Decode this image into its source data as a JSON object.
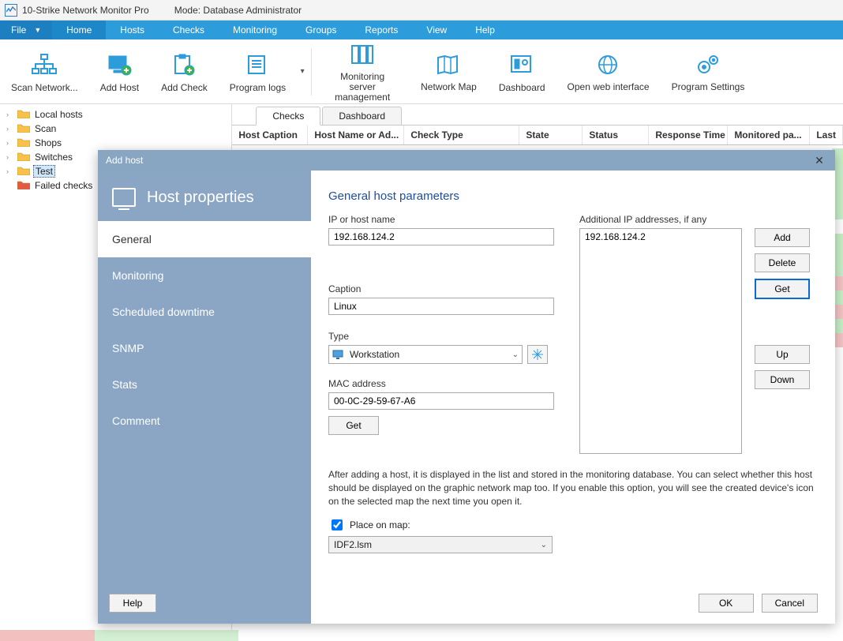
{
  "titlebar": {
    "app_name": "10-Strike Network Monitor Pro",
    "mode_label": "Mode: Database Administrator"
  },
  "menubar": {
    "file": "File",
    "items": [
      "Home",
      "Hosts",
      "Checks",
      "Monitoring",
      "Groups",
      "Reports",
      "View",
      "Help"
    ]
  },
  "toolbar": {
    "scan": "Scan Network...",
    "add_host": "Add Host",
    "add_check": "Add Check",
    "program_logs": "Program logs",
    "mon_server": "Monitoring server management",
    "net_map": "Network Map",
    "dashboard": "Dashboard",
    "open_web": "Open web interface",
    "settings": "Program Settings"
  },
  "tree": {
    "items": [
      {
        "label": "Local hosts",
        "color": "#f6c24a"
      },
      {
        "label": "Scan",
        "color": "#f6c24a"
      },
      {
        "label": "Shops",
        "color": "#f6c24a"
      },
      {
        "label": "Switches",
        "color": "#f6c24a"
      },
      {
        "label": "Test",
        "color": "#f6c24a",
        "selected": true
      },
      {
        "label": "Failed checks",
        "color": "#e05a45",
        "no_expander": true
      }
    ]
  },
  "tabs": {
    "checks": "Checks",
    "dashboard": "Dashboard"
  },
  "grid": {
    "cols": [
      "Host Caption",
      "Host Name or Ad...",
      "Check Type",
      "State",
      "Status",
      "Response Time",
      "Monitored pa...",
      "Last"
    ]
  },
  "dialog": {
    "title": "Add host",
    "side_header": "Host properties",
    "side_items": [
      "General",
      "Monitoring",
      "Scheduled downtime",
      "SNMP",
      "Stats",
      "Comment"
    ],
    "help": "Help",
    "section": "General host parameters",
    "ip_label": "IP or host name",
    "ip_value": "192.168.124.2",
    "addl_ip_label": "Additional IP addresses, if any",
    "addl_ip_value": "192.168.124.2",
    "caption_label": "Caption",
    "caption_value": "Linux",
    "type_label": "Type",
    "type_value": "Workstation",
    "mac_label": "MAC address",
    "mac_value": "00-0C-29-59-67-A6",
    "get": "Get",
    "btns": {
      "add": "Add",
      "delete": "Delete",
      "get": "Get",
      "up": "Up",
      "down": "Down"
    },
    "hint": "After adding a host, it is displayed in the list and stored in the monitoring database. You can select whether this host should be displayed on the graphic network map too. If you enable this option, you will see the created device's icon on the selected map the next time you open it.",
    "place_on_map": "Place on map:",
    "map_value": "IDF2.lsm",
    "ok": "OK",
    "cancel": "Cancel"
  }
}
